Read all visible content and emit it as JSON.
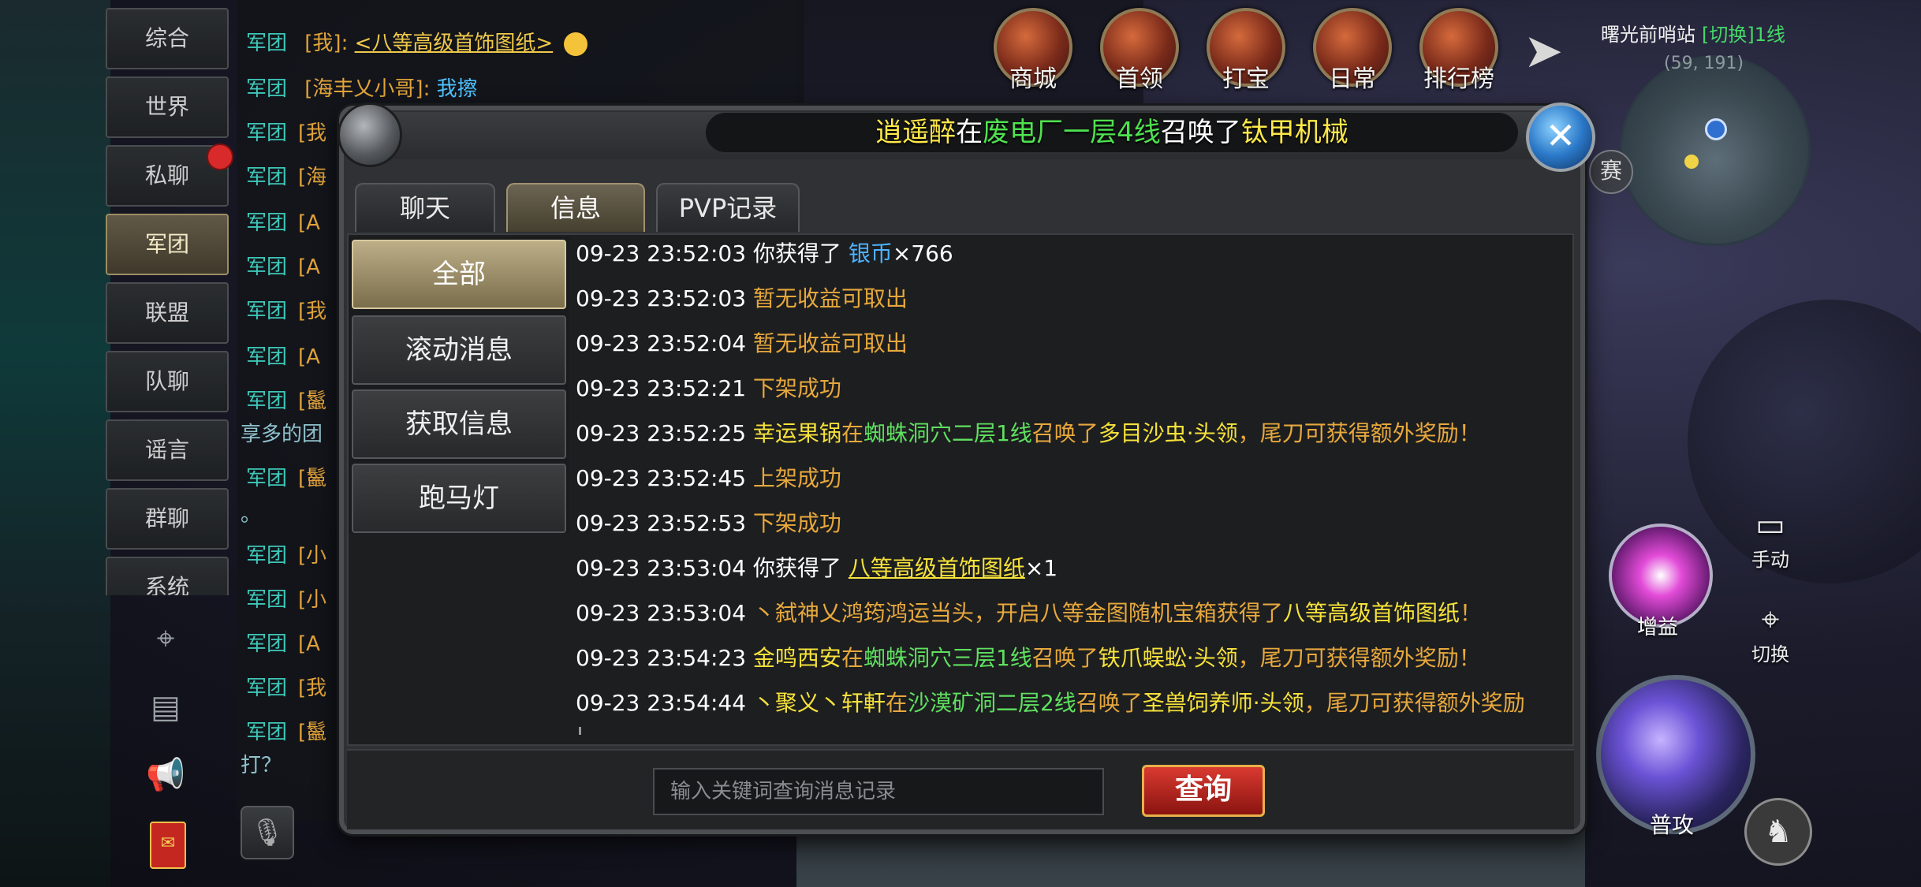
{
  "channels": [
    "综合",
    "世界",
    "私聊",
    "军团",
    "联盟",
    "队聊",
    "谣言",
    "群聊",
    "系统"
  ],
  "active_channel": "军团",
  "chatlog": {
    "rows": [
      {
        "tag": "军团",
        "name": "[我]:",
        "link": "<八等高级首饰图纸>",
        "text": ""
      },
      {
        "tag": "军团",
        "name": "[海丰乂小哥]:",
        "link": "",
        "text": "我擦"
      },
      {
        "tag": "军团",
        "name": "[我",
        "link": "",
        "text": ""
      },
      {
        "tag": "军团",
        "name": "[海",
        "link": "",
        "text": ""
      },
      {
        "tag": "军团",
        "name": "[A",
        "link": "",
        "text": ""
      },
      {
        "tag": "军团",
        "name": "[A",
        "link": "",
        "text": ""
      },
      {
        "tag": "军团",
        "name": "[我",
        "link": "",
        "text": ""
      },
      {
        "tag": "军团",
        "name": "[A",
        "link": "",
        "text": ""
      },
      {
        "tag": "军团",
        "name": "[鬣",
        "link": "",
        "text": ""
      },
      {
        "tag": "军团",
        "name": "[鬣",
        "link": "",
        "text": ""
      },
      {
        "tag": "军团",
        "name": "[小",
        "link": "",
        "text": ""
      },
      {
        "tag": "军团",
        "name": "[小",
        "link": "",
        "text": ""
      },
      {
        "tag": "军团",
        "name": "[A",
        "link": "",
        "text": ""
      },
      {
        "tag": "军团",
        "name": "[我",
        "link": "",
        "text": ""
      },
      {
        "tag": "军团",
        "name": "[鬣",
        "link": "",
        "text": ""
      }
    ],
    "tail1": "享多的团",
    "tail2": "。",
    "tail3": "打？"
  },
  "hud": {
    "items": [
      "商城",
      "首领",
      "打宝",
      "日常",
      "排行榜"
    ],
    "location": "曙光前哨站",
    "switch_line": "[切换]1线",
    "coords": "(59, 191)",
    "sai": "赛"
  },
  "controls": {
    "boost": "增益",
    "attack": "普攻",
    "manual": "手动",
    "switch": "切换"
  },
  "dialog": {
    "banner": {
      "name": "逍遥醉",
      "mid1": "在",
      "place": "废电厂一层4线",
      "mid2": "召唤了",
      "monster": "钛甲机械"
    },
    "tabs": [
      "聊天",
      "信息",
      "PVP记录"
    ],
    "active_tab": "信息",
    "categories": [
      "全部",
      "滚动消息",
      "获取信息",
      "跑马灯"
    ],
    "active_category": "全部",
    "messages": [
      {
        "time": "09-23 23:52:03",
        "parts": [
          [
            "w",
            "你获得了 "
          ],
          [
            "b",
            "银币"
          ],
          [
            "w",
            "×766"
          ]
        ]
      },
      {
        "time": "09-23 23:52:03",
        "parts": [
          [
            "o",
            "暂无收益可取出"
          ]
        ]
      },
      {
        "time": "09-23 23:52:04",
        "parts": [
          [
            "o",
            "暂无收益可取出"
          ]
        ]
      },
      {
        "time": "09-23 23:52:21",
        "parts": [
          [
            "o",
            "下架成功"
          ]
        ]
      },
      {
        "time": "09-23 23:52:25",
        "parts": [
          [
            "y",
            "幸运果锅"
          ],
          [
            "o",
            "在"
          ],
          [
            "g",
            "蜘蛛洞穴二层1线"
          ],
          [
            "o",
            "召唤了"
          ],
          [
            "y",
            "多目沙虫·头领"
          ],
          [
            "o",
            "，尾刀可获得额外奖励！"
          ]
        ]
      },
      {
        "time": "09-23 23:52:45",
        "parts": [
          [
            "o",
            "上架成功"
          ]
        ]
      },
      {
        "time": "09-23 23:52:53",
        "parts": [
          [
            "o",
            "下架成功"
          ]
        ]
      },
      {
        "time": "09-23 23:53:04",
        "parts": [
          [
            "w",
            "你获得了 "
          ],
          [
            "u",
            "八等高级首饰图纸"
          ],
          [
            "w",
            "×1"
          ]
        ]
      },
      {
        "time": "09-23 23:53:04",
        "parts": [
          [
            "o",
            "丶弑神乂鸿筠鸿运当头，开启八等金图随机宝箱获得了"
          ],
          [
            "y",
            "八等高级首饰图纸"
          ],
          [
            "o",
            "！"
          ]
        ]
      },
      {
        "time": "09-23 23:54:23",
        "parts": [
          [
            "y",
            "金鸣西安"
          ],
          [
            "o",
            "在"
          ],
          [
            "g",
            "蜘蛛洞穴三层1线"
          ],
          [
            "o",
            "召唤了"
          ],
          [
            "y",
            "铁爪蜈蚣·头领"
          ],
          [
            "o",
            "，尾刀可获得额外奖励！"
          ]
        ]
      },
      {
        "time": "09-23 23:54:44",
        "parts": [
          [
            "y",
            "丶聚义丶轩軒"
          ],
          [
            "o",
            "在"
          ],
          [
            "g",
            "沙漠矿洞二层2线"
          ],
          [
            "o",
            "召唤了"
          ],
          [
            "y",
            "圣兽饲养师·头领"
          ],
          [
            "o",
            "，尾刀可获得额外奖励"
          ]
        ]
      }
    ],
    "search_placeholder": "输入关键词查询消息记录",
    "query_label": "查询"
  },
  "colors": {
    "timestamp": "#ffffff",
    "system_text": "#e7a83c",
    "player_name": "#f6e23a",
    "place": "#5fe05f",
    "currency": "#4fb3ff",
    "query_button": "#c42a20"
  }
}
